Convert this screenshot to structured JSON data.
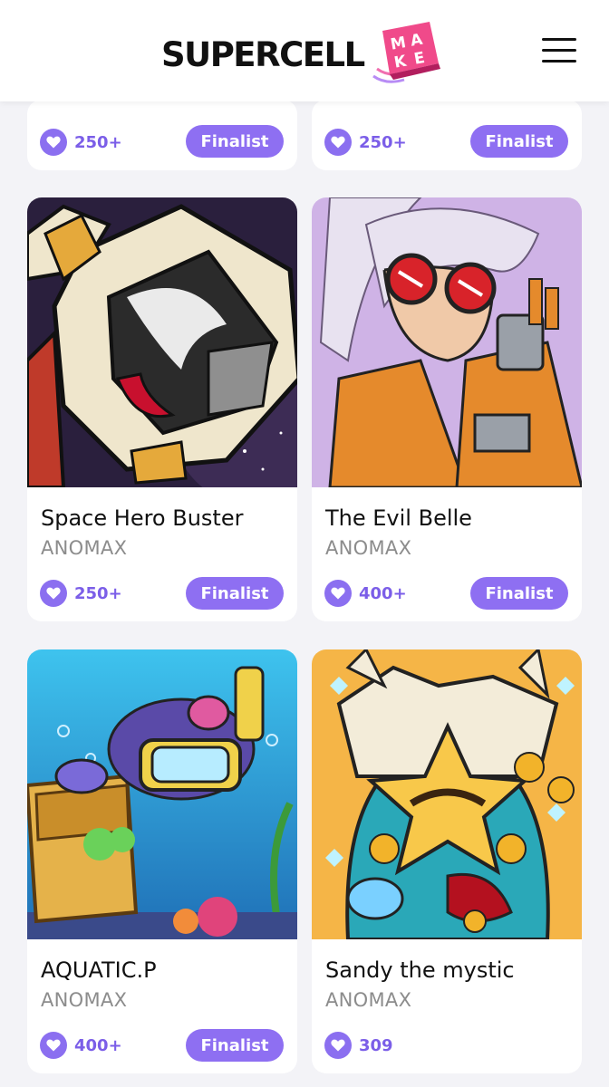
{
  "header": {
    "brand": "SUPERCELL",
    "badge_text": [
      "M",
      "A",
      "K",
      "E"
    ],
    "menu_icon": "hamburger-menu-icon"
  },
  "colors": {
    "accent": "#8e6ff2",
    "likes_text": "#7b5ee8",
    "badge_pink": "#f04a8a"
  },
  "top_cards": [
    {
      "likes": "250+",
      "badge": "Finalist"
    },
    {
      "likes": "250+",
      "badge": "Finalist"
    }
  ],
  "cards": [
    {
      "title": "Space Hero Buster",
      "author": "ANOMAX",
      "likes": "250+",
      "badge": "Finalist"
    },
    {
      "title": "The Evil Belle",
      "author": "ANOMAX",
      "likes": "400+",
      "badge": "Finalist"
    },
    {
      "title": "AQUATIC.P",
      "author": "ANOMAX",
      "likes": "400+",
      "badge": "Finalist"
    },
    {
      "title": "Sandy the mystic",
      "author": "ANOMAX",
      "likes": "309",
      "badge": ""
    }
  ]
}
